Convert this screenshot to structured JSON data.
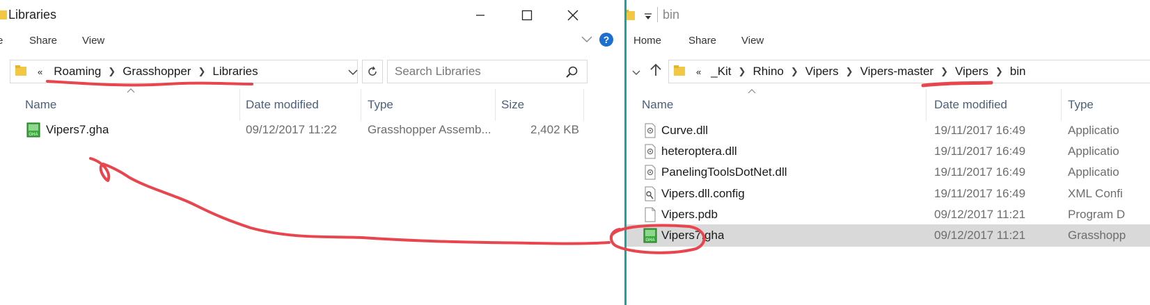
{
  "left": {
    "title": "Libraries",
    "ribbon": [
      "e",
      "Share",
      "View"
    ],
    "breadcrumb": [
      "«",
      "Roaming",
      "Grasshopper",
      "Libraries"
    ],
    "search_placeholder": "Search Libraries",
    "columns": [
      "Name",
      "Date modified",
      "Type",
      "Size"
    ],
    "files": [
      {
        "name": "Vipers7.gha",
        "date": "09/12/2017 11:22",
        "type": "Grasshopper Assemb...",
        "size": "2,402 KB",
        "icon": "gha-icon"
      }
    ]
  },
  "right": {
    "title": "bin",
    "ribbon": [
      "Home",
      "Share",
      "View"
    ],
    "breadcrumb": [
      "«",
      "_Kit",
      "Rhino",
      "Vipers",
      "Vipers-master",
      "Vipers",
      "bin"
    ],
    "columns": [
      "Name",
      "Date modified",
      "Type"
    ],
    "files": [
      {
        "name": "Curve.dll",
        "date": "19/11/2017 16:49",
        "type": "Applicatio",
        "icon": "dll-icon"
      },
      {
        "name": "heteroptera.dll",
        "date": "19/11/2017 16:49",
        "type": "Applicatio",
        "icon": "dll-icon"
      },
      {
        "name": "PanelingToolsDotNet.dll",
        "date": "19/11/2017 16:49",
        "type": "Applicatio",
        "icon": "dll-icon"
      },
      {
        "name": "Vipers.dll.config",
        "date": "19/11/2017 16:49",
        "type": "XML Confi",
        "icon": "config-icon"
      },
      {
        "name": "Vipers.pdb",
        "date": "09/12/2017 11:21",
        "type": "Program D",
        "icon": "file-icon"
      },
      {
        "name": "Vipers7.gha",
        "date": "09/12/2017 11:21",
        "type": "Grasshopp",
        "icon": "gha-icon",
        "selected": true
      }
    ]
  },
  "colors": {
    "accent_teal": "#1aa3a3",
    "annotation_red": "#e8454e",
    "help_blue": "#1c6fd1",
    "header_text": "#4c607a"
  }
}
